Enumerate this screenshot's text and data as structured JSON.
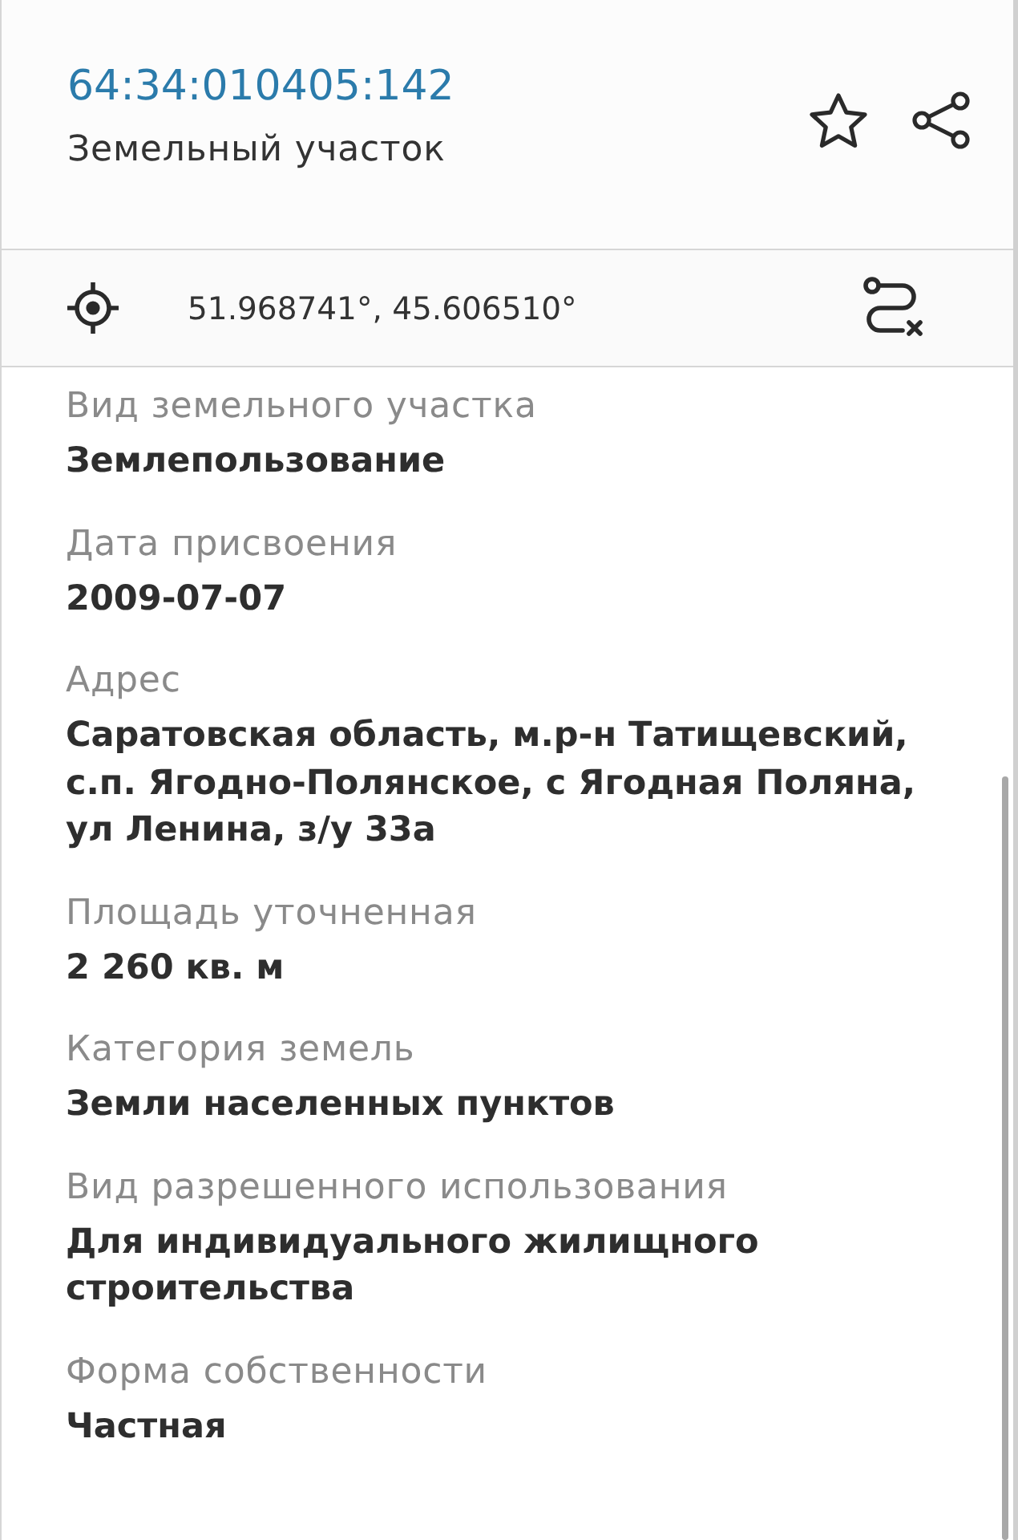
{
  "header": {
    "cadastral_number": "64:34:010405:142",
    "object_type": "Земельный участок"
  },
  "coordinates": {
    "text": "51.968741°, 45.606510°"
  },
  "fields": [
    {
      "label": "Вид земельного участка",
      "value": "Землепользование"
    },
    {
      "label": "Дата присвоения",
      "value": "2009-07-07"
    },
    {
      "label": "Адрес",
      "value": "Саратовская область, м.р-н Татищевский, с.п. Ягодно-Полянское, с Ягодная Поляна, ул Ленина, з/у 33а"
    },
    {
      "label": "Площадь уточненная",
      "value": "2 260 кв. м"
    },
    {
      "label": "Категория земель",
      "value": "Земли населенных пунктов"
    },
    {
      "label": "Вид разрешенного использования",
      "value": "Для индивидуального жилищного строительства"
    },
    {
      "label": "Форма собственности",
      "value": "Частная"
    }
  ]
}
